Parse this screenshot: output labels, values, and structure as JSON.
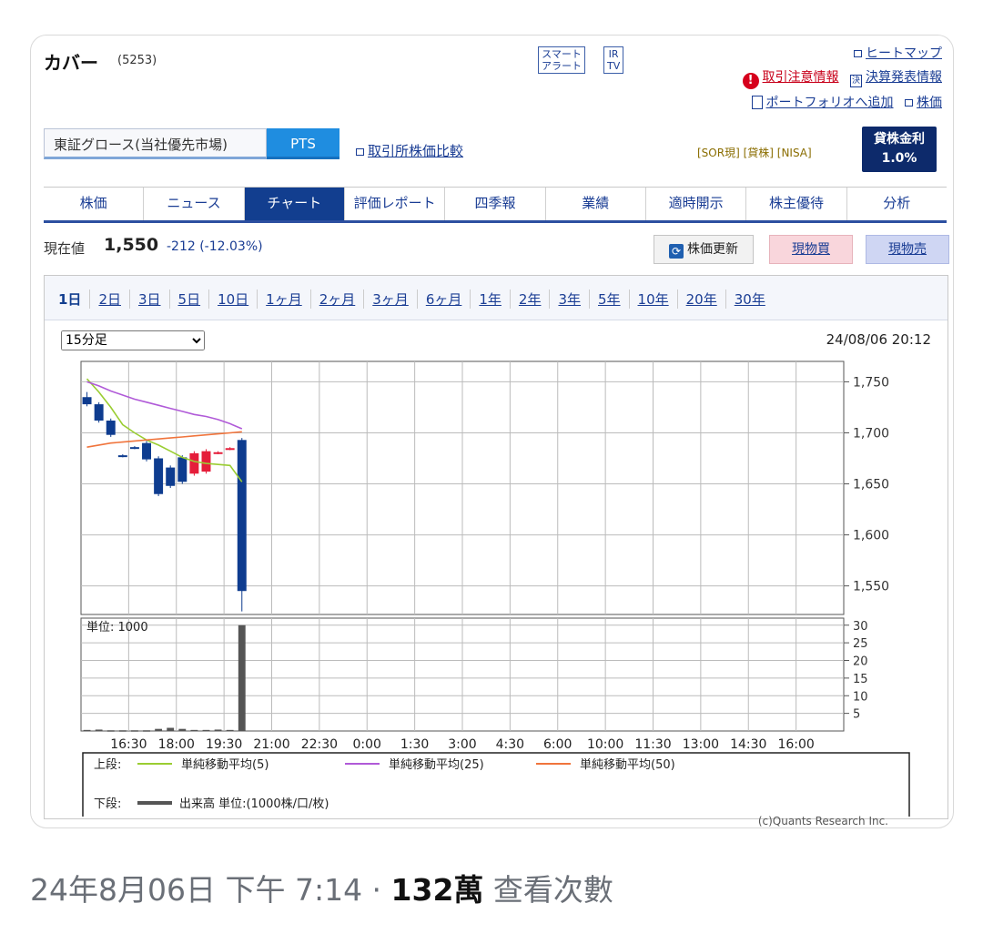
{
  "header": {
    "company_name": "カバー",
    "stock_code": "(5253)",
    "smart_alert": [
      "スマート",
      "アラート"
    ],
    "ir_tv": [
      "IR",
      "TV"
    ],
    "heatmap_link": "ヒートマップ",
    "caution_link": "取引注意情報",
    "earnings_link": "決算発表情報",
    "portfolio_link": "ポートフォリオへ追加",
    "stock_price_link": "株価"
  },
  "market": {
    "market_tab": "東証グロース(当社優先市場)",
    "pts_tab": "PTS",
    "compare_link": "取引所株価比較",
    "tags": "[SOR現] [貸株] [NISA]",
    "lending_label": "貸株金利",
    "lending_rate": "1.0%"
  },
  "tabs": [
    "株価",
    "ニュース",
    "チャート",
    "評価レポート",
    "四季報",
    "業績",
    "適時開示",
    "株主優待",
    "分析"
  ],
  "active_tab": "チャート",
  "quote": {
    "label": "現在値",
    "price": "1,550",
    "change": "-212 (-12.03%)",
    "refresh_button": "株価更新",
    "buy_button": "現物買",
    "sell_button": "現物売"
  },
  "periods": [
    "1日",
    "2日",
    "3日",
    "5日",
    "10日",
    "1ヶ月",
    "2ヶ月",
    "3ヶ月",
    "6ヶ月",
    "1年",
    "2年",
    "3年",
    "5年",
    "10年",
    "20年",
    "30年"
  ],
  "selected_period": "1日",
  "interval_select": "15分足",
  "chart_timestamp": "24/08/06 20:12",
  "chart_data": {
    "type": "candlestick",
    "price_axis": {
      "ticks": [
        1750,
        1700,
        1650,
        1600,
        1550
      ],
      "labels": [
        "1,750",
        "1,700",
        "1,650",
        "1,600",
        "1,550"
      ],
      "range": [
        1522,
        1770
      ]
    },
    "volume_axis": {
      "ticks": [
        30,
        25,
        20,
        15,
        10,
        5
      ],
      "range": [
        0,
        32
      ],
      "unit_label": "単位: 1000"
    },
    "x_labels": [
      "16:30",
      "18:00",
      "19:30",
      "21:00",
      "22:30",
      "0:00",
      "1:30",
      "3:00",
      "4:30",
      "6:00",
      "10:00",
      "11:30",
      "13:00",
      "14:30",
      "16:00"
    ],
    "candles": [
      {
        "slot": 0,
        "open": 1735,
        "close": 1728,
        "high": 1740,
        "low": 1726
      },
      {
        "slot": 1,
        "open": 1728,
        "close": 1712,
        "high": 1730,
        "low": 1710
      },
      {
        "slot": 2,
        "open": 1712,
        "close": 1698,
        "high": 1714,
        "low": 1696
      },
      {
        "slot": 3,
        "open": 1678,
        "close": 1677,
        "high": 1679,
        "low": 1676
      },
      {
        "slot": 4,
        "open": 1686,
        "close": 1685,
        "high": 1687,
        "low": 1684
      },
      {
        "slot": 5,
        "open": 1690,
        "close": 1674,
        "high": 1692,
        "low": 1672
      },
      {
        "slot": 6,
        "open": 1675,
        "close": 1640,
        "high": 1677,
        "low": 1638
      },
      {
        "slot": 7,
        "open": 1666,
        "close": 1648,
        "high": 1668,
        "low": 1646
      },
      {
        "slot": 8,
        "open": 1676,
        "close": 1652,
        "high": 1678,
        "low": 1650
      },
      {
        "slot": 9,
        "open": 1660,
        "close": 1680,
        "high": 1682,
        "low": 1658
      },
      {
        "slot": 10,
        "open": 1662,
        "close": 1682,
        "high": 1684,
        "low": 1660
      },
      {
        "slot": 11,
        "open": 1680,
        "close": 1681,
        "high": 1682,
        "low": 1679
      },
      {
        "slot": 12,
        "open": 1684,
        "close": 1685,
        "high": 1686,
        "low": 1683
      },
      {
        "slot": 13,
        "open": 1693,
        "close": 1545,
        "high": 1695,
        "low": 1525
      }
    ],
    "moving_averages": [
      {
        "name": "単純移動平均(5)",
        "color": "#9acd32",
        "values": [
          1753,
          1740,
          1725,
          1708,
          1700,
          1693,
          1688,
          1682,
          1676,
          1672,
          1670,
          1669,
          1668,
          1652
        ]
      },
      {
        "name": "単純移動平均(25)",
        "color": "#b05ad8",
        "values": [
          1750,
          1746,
          1741,
          1737,
          1733,
          1730,
          1727,
          1724,
          1721,
          1718,
          1716,
          1713,
          1709,
          1704
        ]
      },
      {
        "name": "単純移動平均(50)",
        "color": "#f0743c",
        "values": [
          1686,
          1688,
          1690,
          1691,
          1692,
          1693,
          1694,
          1695,
          1696,
          1697,
          1698,
          1699,
          1700,
          1701
        ]
      }
    ],
    "volume": [
      0.3,
      0.4,
      0.2,
      0.2,
      0.2,
      0.2,
      0.6,
      0.9,
      0.6,
      0.3,
      0.3,
      0.4,
      0.3,
      30
    ],
    "legend": {
      "upper_label": "上段:",
      "lower_label": "下段:",
      "volume_entry": "出来高 単位:(1000株/口/枚)"
    }
  },
  "copyright": "(c)Quants Research Inc.",
  "post_meta": {
    "datetime": "24年8月06日 下午 7:14 · ",
    "views_count": "132萬",
    "views_label": " 查看次數"
  },
  "colors": {
    "nav_active": "#123e8f",
    "link": "#1a3d94",
    "down_candle": "#0e3c8f",
    "up_candle": "#e51d3a",
    "volume_bar": "#555555"
  }
}
